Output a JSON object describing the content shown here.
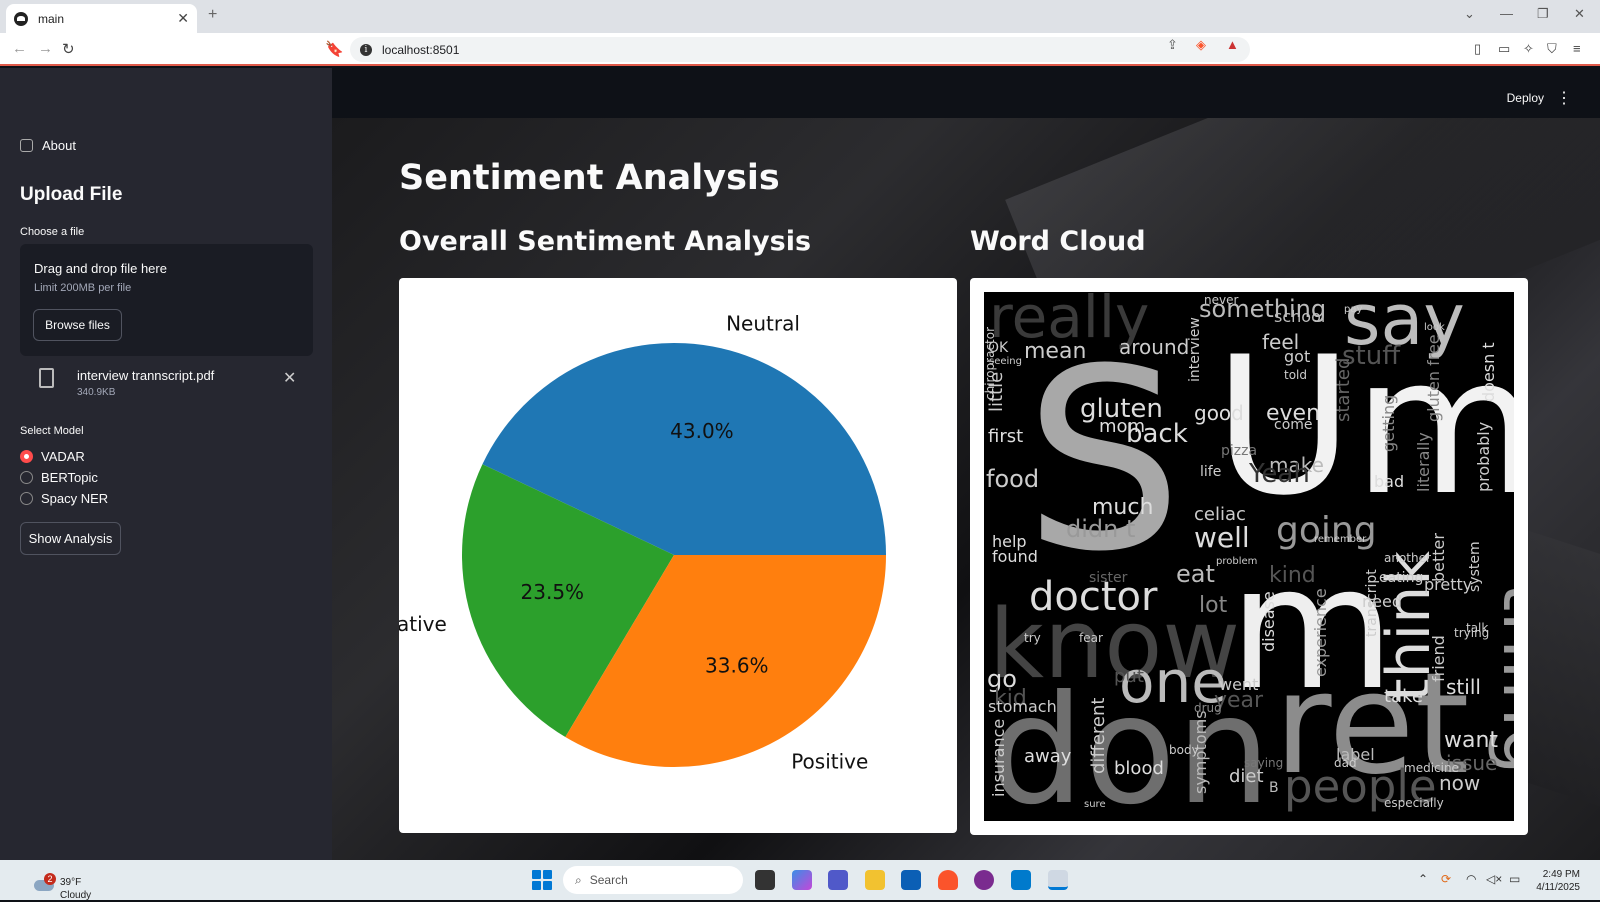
{
  "browser": {
    "tab_title": "main",
    "new_tab": "+",
    "url": "localhost:8501"
  },
  "app": {
    "deploy_label": "Deploy"
  },
  "sidebar": {
    "about_label": "About",
    "upload_heading": "Upload File",
    "choose_label": "Choose a file",
    "dropzone_title": "Drag and drop file here",
    "dropzone_limit": "Limit 200MB per file",
    "browse_label": "Browse files",
    "file_name": "interview trannscript.pdf",
    "file_size": "340.9KB",
    "select_model_label": "Select Model",
    "models": [
      "VADAR",
      "BERTopic",
      "Spacy NER"
    ],
    "selected_model": "VADAR",
    "show_analysis_label": "Show Analysis"
  },
  "main": {
    "page_title": "Sentiment Analysis",
    "pie_heading": "Overall Sentiment Analysis",
    "wordcloud_heading": "Word Cloud"
  },
  "chart_data": {
    "type": "pie",
    "labels": [
      "Neutral",
      "Negative",
      "Positive"
    ],
    "values": [
      43.0,
      23.5,
      33.6
    ],
    "value_labels": [
      "43.0%",
      "23.5%",
      "33.6%"
    ],
    "colors": [
      "#1f77b4",
      "#2ca02c",
      "#ff7f0e"
    ],
    "start_angle_deg": 0
  },
  "wordcloud": {
    "words": [
      "really",
      "say",
      "something",
      "Um",
      "S",
      "know",
      "thing",
      "think",
      "don",
      "ret",
      "one",
      "doctor",
      "people",
      "m",
      "going",
      "well",
      "gluten",
      "food",
      "back",
      "mean",
      "around",
      "feel",
      "stuff",
      "even",
      "make",
      "good",
      "first",
      "much",
      "didn t",
      "celiac",
      "eat",
      "lot",
      "go",
      "kid",
      "away",
      "blood",
      "diet",
      "want",
      "still",
      "now",
      "issue",
      "label",
      "different",
      "symptoms",
      "insurance",
      "pizza",
      "help",
      "found",
      "friend",
      "better",
      "pretty",
      "need",
      "bad",
      "doesn t",
      "probably",
      "take",
      "year",
      "went",
      "experience",
      "disease",
      "school",
      "Yeah",
      "got",
      "told",
      "come",
      "mom",
      "life",
      "little",
      "OK",
      "put",
      "stomach",
      "transcript",
      "interview",
      "started",
      "getting",
      "gluten free",
      "literally",
      "system",
      "eating",
      "kind",
      "B",
      "especially",
      "trying",
      "talk",
      "saying",
      "sure",
      "body",
      "dad",
      "medicine",
      "drug",
      "try",
      "fear",
      "sister",
      "another",
      "remember",
      "problem",
      "chiropractor",
      "seeing",
      "never",
      "pay",
      "look"
    ]
  },
  "taskbar": {
    "weather_temp": "39°F",
    "weather_desc": "Cloudy",
    "weather_badge": "2",
    "search_label": "Search",
    "time": "2:49 PM",
    "date": "4/11/2025"
  }
}
